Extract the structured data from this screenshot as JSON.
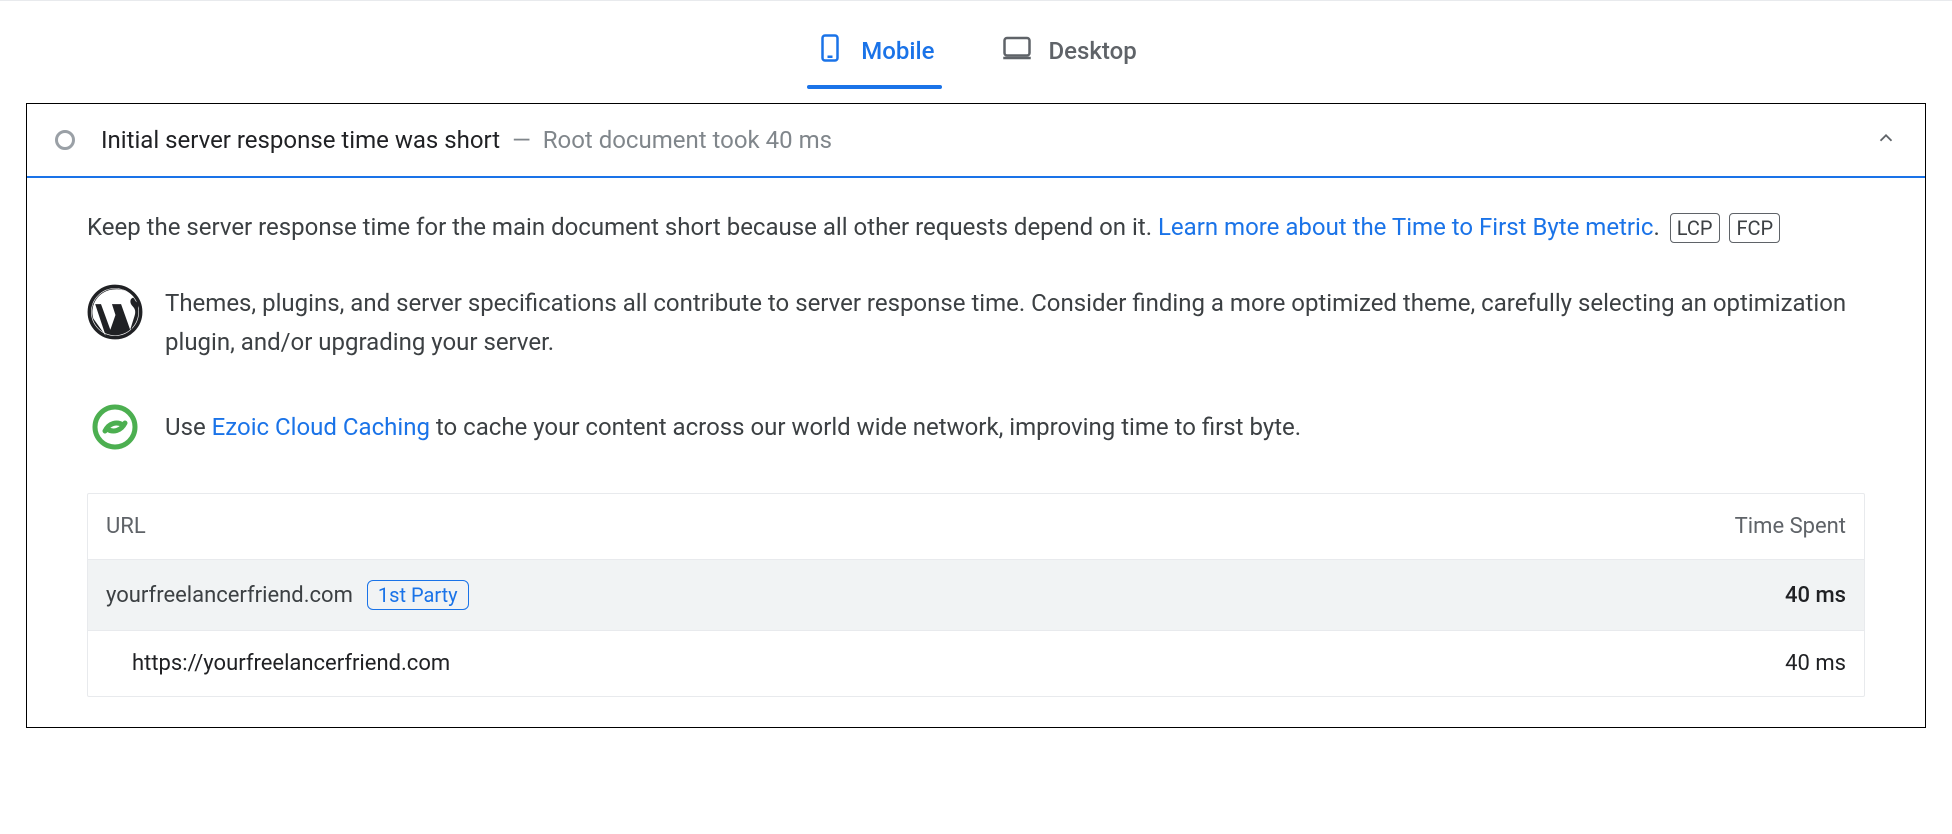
{
  "tabs": {
    "mobile": "Mobile",
    "desktop": "Desktop"
  },
  "audit": {
    "title": "Initial server response time was short",
    "dash": "—",
    "subtitle": "Root document took 40 ms",
    "description_pre": "Keep the server response time for the main document short because all other requests depend on it. ",
    "learn_more": "Learn more about the Time to First Byte metric",
    "period": ".",
    "badge_lcp": "LCP",
    "badge_fcp": "FCP"
  },
  "tips": {
    "wordpress": "Themes, plugins, and server specifications all contribute to server response time. Consider finding a more optimized theme, carefully selecting an optimization plugin, and/or upgrading your server.",
    "ezoic_pre": "Use ",
    "ezoic_link": "Ezoic Cloud Caching",
    "ezoic_post": " to cache your content across our world wide network, improving time to first byte."
  },
  "table": {
    "header_url": "URL",
    "header_time": "Time Spent",
    "group_domain": "yourfreelancerfriend.com",
    "group_party": "1st Party",
    "group_time": "40 ms",
    "row_url": "https://yourfreelancerfriend.com",
    "row_time": "40 ms"
  }
}
